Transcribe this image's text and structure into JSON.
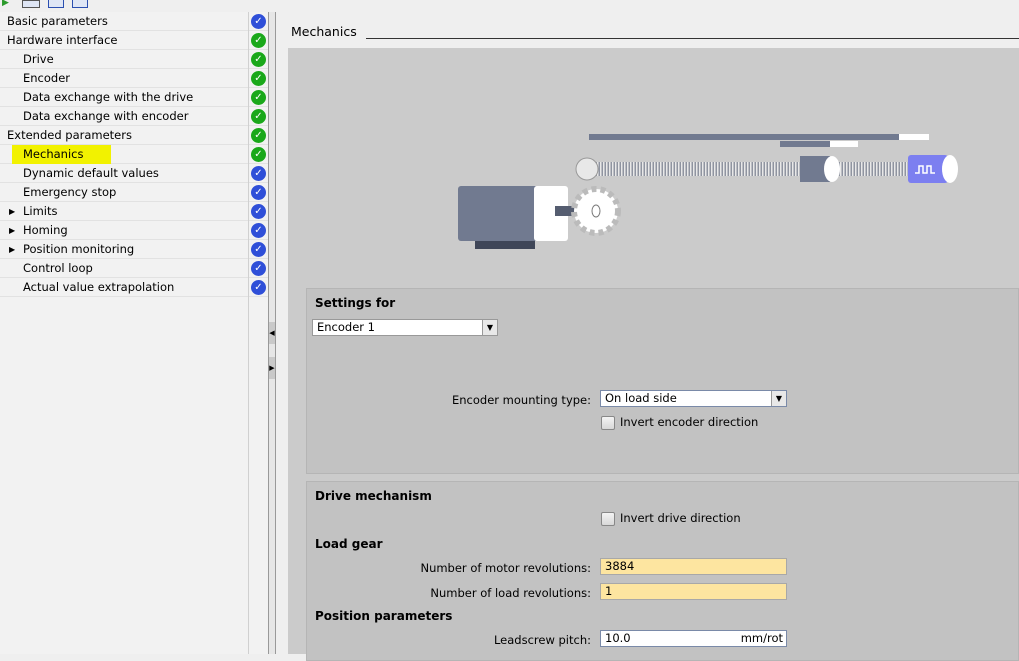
{
  "tree": [
    {
      "label": "Basic parameters",
      "indent": 0,
      "status": "blue"
    },
    {
      "label": "Hardware interface",
      "indent": 0,
      "status": "green",
      "expander": "open"
    },
    {
      "label": "Drive",
      "indent": 1,
      "status": "green"
    },
    {
      "label": "Encoder",
      "indent": 1,
      "status": "green"
    },
    {
      "label": "Data exchange with the drive",
      "indent": 1,
      "status": "green"
    },
    {
      "label": "Data exchange with encoder",
      "indent": 1,
      "status": "green"
    },
    {
      "label": "Extended parameters",
      "indent": 0,
      "status": "green",
      "expander": "open"
    },
    {
      "label": "Mechanics",
      "indent": 1,
      "status": "green",
      "selected": true
    },
    {
      "label": "Dynamic default values",
      "indent": 1,
      "status": "blue"
    },
    {
      "label": "Emergency stop",
      "indent": 1,
      "status": "blue"
    },
    {
      "label": "Limits",
      "indent": 1,
      "status": "blue",
      "expander": "closed"
    },
    {
      "label": "Homing",
      "indent": 1,
      "status": "blue",
      "expander": "closed"
    },
    {
      "label": "Position monitoring",
      "indent": 1,
      "status": "blue",
      "expander": "closed"
    },
    {
      "label": "Control loop",
      "indent": 1,
      "status": "blue"
    },
    {
      "label": "Actual value extrapolation",
      "indent": 1,
      "status": "blue"
    }
  ],
  "colors": {
    "green": "#1aa81a",
    "blue": "#2f4fd8",
    "highlight": "#f2f200",
    "input_yellow": "#fde5a0"
  },
  "header": {
    "title": "Mechanics"
  },
  "settings": {
    "title": "Settings for",
    "selector": "Encoder 1",
    "mounting_label": "Encoder mounting type:",
    "mounting_value": "On load side",
    "invert_encoder": "Invert encoder direction"
  },
  "drive": {
    "title": "Drive mechanism",
    "invert_drive": "Invert drive direction",
    "load_gear_title": "Load gear",
    "motor_rev_label": "Number of motor revolutions:",
    "motor_rev_value": "3884",
    "load_rev_label": "Number of load revolutions:",
    "load_rev_value": "1",
    "position_title": "Position parameters",
    "pitch_label": "Leadscrew pitch:",
    "pitch_value": "10.0",
    "pitch_unit": "mm/rot"
  }
}
